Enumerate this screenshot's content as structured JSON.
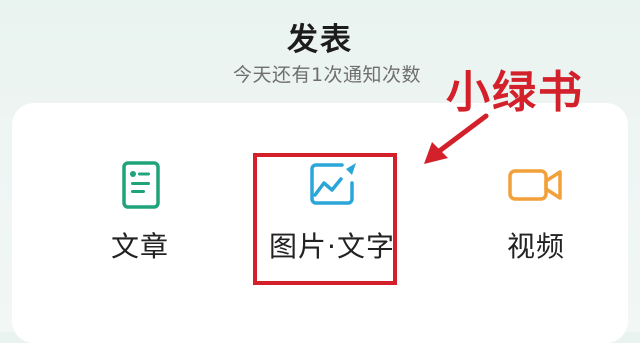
{
  "header": {
    "title": "发表",
    "subtitle": "今天还有1次通知次数"
  },
  "options": [
    {
      "label": "文章",
      "icon": "document-icon",
      "color": "#1fa37a"
    },
    {
      "label": "图片·文字",
      "icon": "image-icon",
      "color": "#2aa6d8"
    },
    {
      "label": "视频",
      "icon": "video-camera-icon",
      "color": "#f2a13a"
    }
  ],
  "annotation": {
    "text": "小绿书",
    "color": "#d3202a"
  }
}
